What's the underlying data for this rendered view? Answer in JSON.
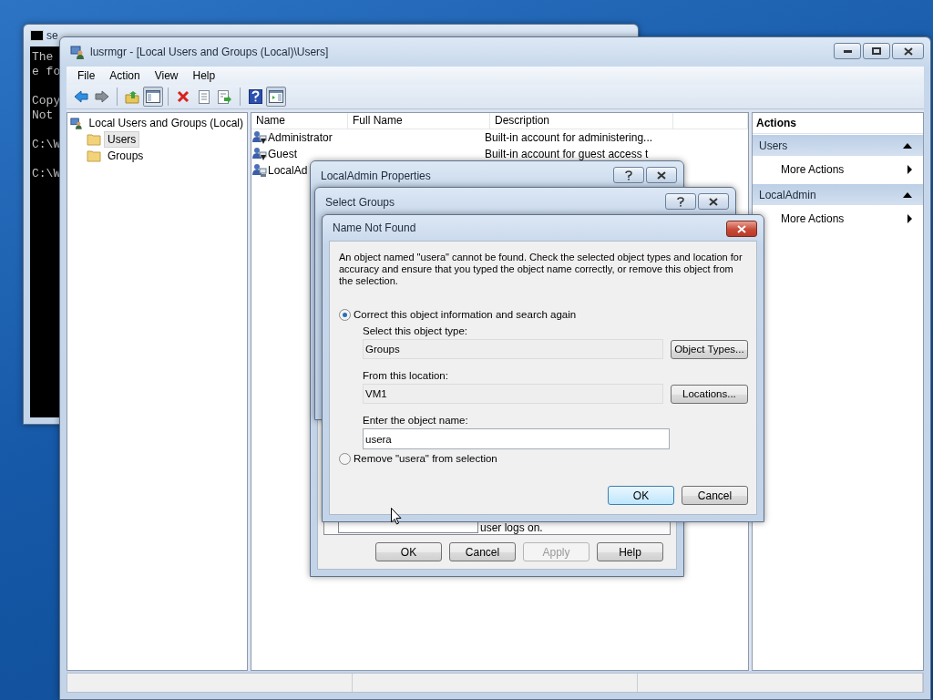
{
  "console": {
    "title": "se",
    "blocks": [
      [
        "The",
        "e fo"
      ],
      [
        "Copy",
        "Not"
      ],
      [
        "C:\\W"
      ],
      [
        "C:\\W"
      ]
    ]
  },
  "main_window": {
    "title": "lusrmgr - [Local Users and Groups (Local)\\Users]",
    "menu": [
      "File",
      "Action",
      "View",
      "Help"
    ],
    "toolbar": [
      {
        "kind": "back",
        "pressed": false
      },
      {
        "kind": "forward",
        "pressed": false
      },
      {
        "kind": "separator"
      },
      {
        "kind": "up",
        "pressed": false
      },
      {
        "kind": "tree-toggle",
        "pressed": true
      },
      {
        "kind": "separator"
      },
      {
        "kind": "delete",
        "pressed": false
      },
      {
        "kind": "properties",
        "pressed": false
      },
      {
        "kind": "export",
        "pressed": false
      },
      {
        "kind": "separator"
      },
      {
        "kind": "help",
        "pressed": false
      },
      {
        "kind": "pane-toggle",
        "pressed": true
      }
    ],
    "tree": {
      "label": "Local Users and Groups (Local)",
      "children": [
        {
          "label": "Users",
          "selected": true
        },
        {
          "label": "Groups",
          "selected": false
        }
      ]
    },
    "list": {
      "columns": [
        "Name",
        "Full Name",
        "Description"
      ],
      "rows": [
        {
          "name": "Administrator",
          "description": "Built-in account for administering...",
          "disabled": true
        },
        {
          "name": "Guest",
          "description": "Built-in account for guest access t",
          "disabled": true
        },
        {
          "name": "LocalAd",
          "disabled": false
        }
      ]
    },
    "actions": {
      "title": "Actions",
      "sections": [
        {
          "title": "Users",
          "expanded": true,
          "items": [
            "More Actions"
          ]
        },
        {
          "title": "LocalAdmin",
          "expanded": true,
          "items": [
            "More Actions"
          ]
        }
      ]
    }
  },
  "properties_dialog": {
    "title": "LocalAdmin Properties",
    "text": "user logs on.",
    "buttons": [
      {
        "label": "OK",
        "disabled": false
      },
      {
        "label": "Cancel",
        "disabled": false
      },
      {
        "label": "Apply",
        "disabled": true
      },
      {
        "label": "Help",
        "disabled": false
      }
    ]
  },
  "select_groups_dialog": {
    "title": "Select Groups"
  },
  "name_not_found_dialog": {
    "title": "Name Not Found",
    "message": "An object named \"usera\" cannot be found. Check the selected object types and location for accuracy and ensure that you typed the object name correctly, or remove this object from the selection.",
    "options": [
      {
        "label": "Correct this object information and search again",
        "selected": true
      },
      {
        "label": "Remove \"usera\" from selection",
        "selected": false
      }
    ],
    "object_type": {
      "label": "Select this object type:",
      "value": "Groups",
      "button": "Object Types..."
    },
    "location": {
      "label": "From this location:",
      "value": "VM1",
      "button": "Locations..."
    },
    "object_name": {
      "label": "Enter the object name:",
      "value": "usera"
    },
    "buttons": [
      {
        "label": "OK",
        "default": true
      },
      {
        "label": "Cancel",
        "default": false
      }
    ]
  }
}
